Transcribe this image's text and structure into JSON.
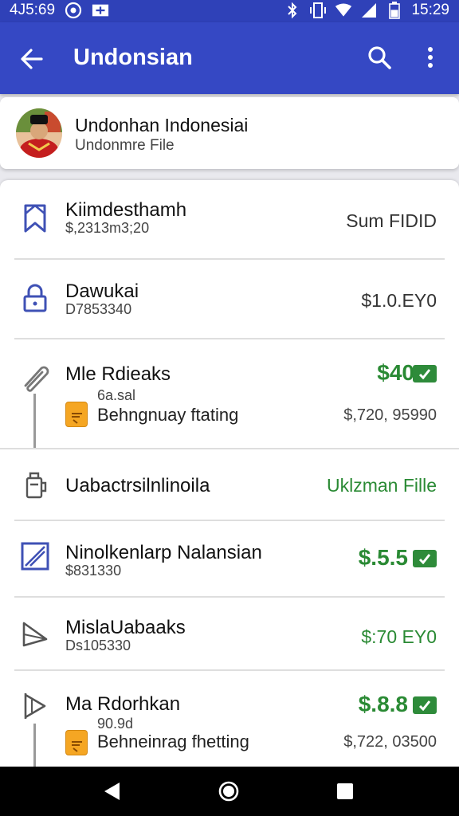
{
  "status_bar": {
    "left_time": "4J5:69",
    "right_time": "15:29",
    "battery_level": 0.55
  },
  "app_bar": {
    "title": "Undonsian"
  },
  "profile": {
    "name": "Undonhan Indonesiai",
    "subtitle": "Undonmre File"
  },
  "rows": [
    {
      "title": "Kiimdesthamh",
      "subtitle": "$,2313m3;20",
      "right_text": "Sum FIDID",
      "icon": "bookmark-icon"
    },
    {
      "title": "Dawukai",
      "subtitle": "D7853340",
      "right_text": "$1.0.EY0",
      "icon": "lock-icon"
    },
    {
      "title": "Mle Rdieaks",
      "amount": "$40",
      "detail": "6a.sal",
      "file_label": "Behngnuay ftating",
      "file_amount": "$,720, 95990",
      "icon": "paperclip-icon"
    },
    {
      "title": "Uabactrsilnlinoila",
      "right_text": "Uklzman Fille",
      "icon": "bin-icon"
    },
    {
      "title": "Ninolkenlarp Nalansian",
      "subtitle": "$831330",
      "amount": "$.5.5",
      "icon": "edit-frame-icon"
    },
    {
      "title": "MislaUabaaks",
      "subtitle": "Ds105330",
      "right_text": "$:70 EY0",
      "icon": "tag-icon"
    },
    {
      "title": "Ma Rdorhkan",
      "amount": "$.8.8",
      "detail": "90.9d",
      "file_label": "Behneinrag fhetting",
      "file_amount": "$,722, 03500",
      "icon": "flag-icon"
    }
  ],
  "colors": {
    "primary": "#3548c4",
    "status": "#2f41b8",
    "green": "#2a8a34"
  }
}
